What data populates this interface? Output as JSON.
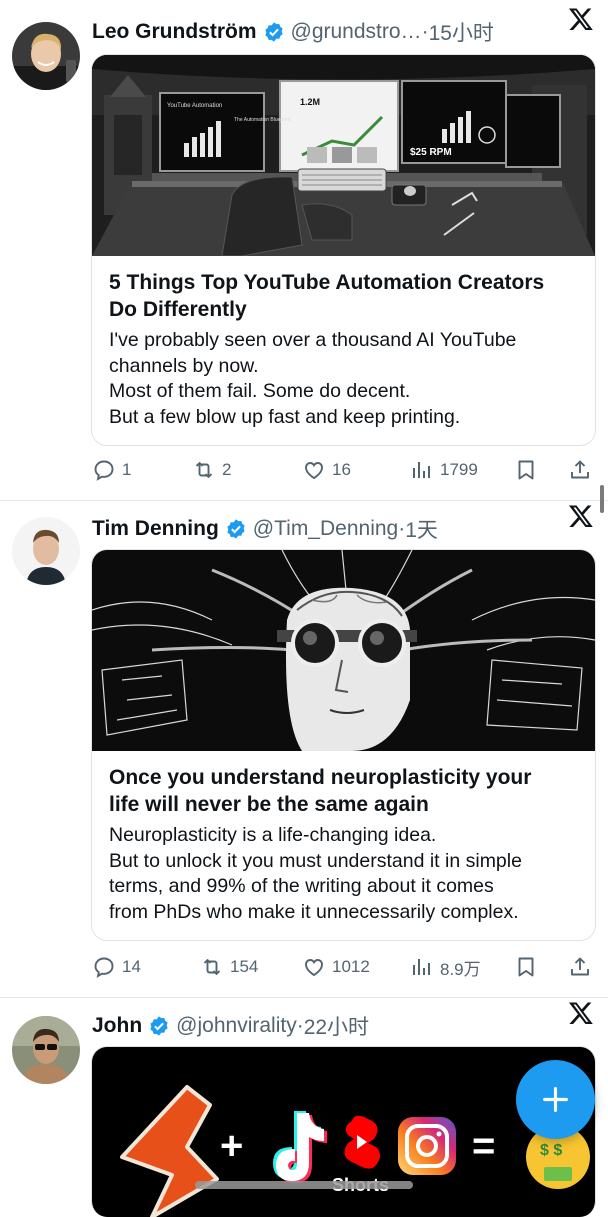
{
  "tweets": [
    {
      "author": "Leo Grundström",
      "handle": "@grundstro…",
      "time": "15小时",
      "card_title_lines": [
        "5 Things Top YouTube Automation Creators",
        "Do Differently"
      ],
      "card_desc_lines": [
        "I've probably seen over a thousand AI YouTube",
        "channels by now.",
        "Most of them fail. Some do decent.",
        "But a few blow up fast and keep printing."
      ],
      "image_texts": [
        "YouTube Automation",
        "1.2M",
        "$25 RPM",
        "The Automation Blueprint"
      ],
      "replies": "1",
      "reposts": "2",
      "likes": "16",
      "views": "1799"
    },
    {
      "author": "Tim Denning",
      "handle": "@Tim_Denning",
      "time": "1天",
      "card_title_lines": [
        "Once you understand neuroplasticity your",
        "life will never be the same again"
      ],
      "card_desc_lines": [
        "Neuroplasticity is a life-changing idea.",
        "But to unlock it you must understand it in simple",
        "terms, and 99% of the writing about it comes",
        "from PhDs who make it unnecessarily complex."
      ],
      "replies": "14",
      "reposts": "154",
      "likes": "1012",
      "views": "8.9万"
    },
    {
      "author": "John",
      "handle": "@johnvirality",
      "time": "22小时",
      "image_texts": [
        "+",
        "=",
        "Shorts"
      ]
    }
  ],
  "separator": "·",
  "colors": {
    "accent": "#1d9bf0",
    "text": "#0f1419",
    "muted": "#536471"
  },
  "icons": [
    "verified-badge-icon",
    "x-logo-icon",
    "reply-icon",
    "repost-icon",
    "like-icon",
    "views-icon",
    "bookmark-icon",
    "share-icon",
    "compose-plus-icon"
  ]
}
